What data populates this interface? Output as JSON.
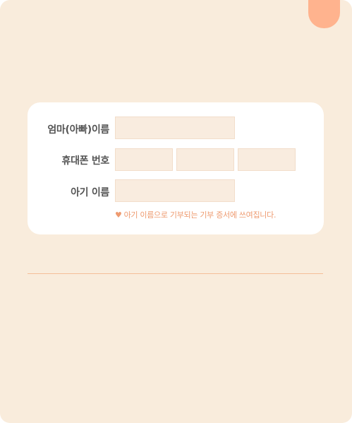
{
  "form": {
    "parent_name_label": "엄마(아빠)이름",
    "parent_name_value": "",
    "phone_label": "휴대폰 번호",
    "phone_part1_value": "",
    "phone_part2_value": "",
    "phone_part3_value": "",
    "baby_name_label": "아기 이름",
    "baby_name_value": "",
    "note_icon": "heart-icon",
    "note_text": "아기 이름으로 기부되는 기부 증서에 쓰여집니다."
  },
  "colors": {
    "page_background": "#f9ecdc",
    "accent": "#ffb38e",
    "note_text": "#ee9a6f",
    "field_background": "#f9ecdf",
    "divider": "#f4be98"
  }
}
